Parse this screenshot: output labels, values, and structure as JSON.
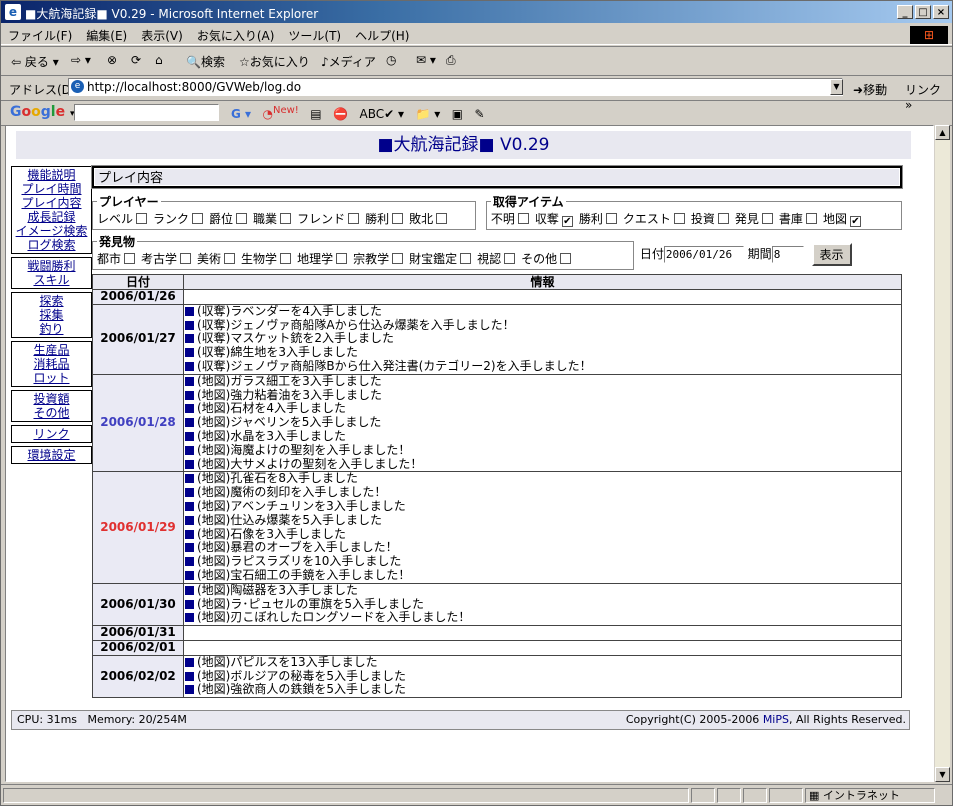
{
  "window": {
    "title": "■大航海記録■ V0.29 - Microsoft Internet Explorer"
  },
  "menu": [
    "ファイル(F)",
    "編集(E)",
    "表示(V)",
    "お気に入り(A)",
    "ツール(T)",
    "ヘルプ(H)"
  ],
  "toolbar": {
    "back": "戻る",
    "search": "検索",
    "favorites": "お気に入り",
    "media": "メディア"
  },
  "address": {
    "label": "アドレス(D)",
    "url": "http://localhost:8000/GVWeb/log.do",
    "go": "移動",
    "links": "リンク"
  },
  "google": {
    "logo": "Google",
    "new_badge": "New!",
    "search_value": ""
  },
  "page": {
    "title": "■大航海記録■ V0.29",
    "section_title": "プレイ内容"
  },
  "sidebar": [
    [
      "機能説明",
      "プレイ時間",
      "プレイ内容",
      "成長記録",
      "イメージ検索",
      "ログ検索"
    ],
    [
      "戦闘勝利",
      "スキル"
    ],
    [
      "探索",
      "採集",
      "釣り"
    ],
    [
      "生産品",
      "消耗品",
      "ロット"
    ],
    [
      "投資額",
      "その他"
    ],
    [
      "リンク"
    ],
    [
      "環境設定"
    ]
  ],
  "filters": {
    "player": {
      "legend": "プレイヤー",
      "items": [
        {
          "label": "レベル",
          "checked": false
        },
        {
          "label": "ランク",
          "checked": false
        },
        {
          "label": "爵位",
          "checked": false
        },
        {
          "label": "職業",
          "checked": false
        },
        {
          "label": "フレンド",
          "checked": false
        },
        {
          "label": "勝利",
          "checked": false
        },
        {
          "label": "敗北",
          "checked": false
        }
      ]
    },
    "items": {
      "legend": "取得アイテム",
      "items": [
        {
          "label": "不明",
          "checked": false
        },
        {
          "label": "収奪",
          "checked": true
        },
        {
          "label": "勝利",
          "checked": false
        },
        {
          "label": "クエスト",
          "checked": false
        },
        {
          "label": "投資",
          "checked": false
        },
        {
          "label": "発見",
          "checked": false
        },
        {
          "label": "書庫",
          "checked": false
        },
        {
          "label": "地図",
          "checked": true
        }
      ]
    },
    "discovery": {
      "legend": "発見物",
      "items": [
        {
          "label": "都市",
          "checked": false
        },
        {
          "label": "考古学",
          "checked": false
        },
        {
          "label": "美術",
          "checked": false
        },
        {
          "label": "生物学",
          "checked": false
        },
        {
          "label": "地理学",
          "checked": false
        },
        {
          "label": "宗教学",
          "checked": false
        },
        {
          "label": "財宝鑑定",
          "checked": false
        },
        {
          "label": "視認",
          "checked": false
        },
        {
          "label": "その他",
          "checked": false
        }
      ]
    },
    "date_label": "日付",
    "date_value": "2006/01/26",
    "period_label": "期間",
    "period_value": "8",
    "show_button": "表示"
  },
  "table": {
    "headers": [
      "日付",
      "情報"
    ],
    "rows": [
      {
        "date": "2006/01/26",
        "style": "",
        "entries": []
      },
      {
        "date": "2006/01/27",
        "style": "",
        "entries": [
          "(収奪)ラベンダーを4入手しました",
          "(収奪)ジェノヴァ商船隊Aから仕込み爆薬を入手しました！",
          "(収奪)マスケット銃を2入手しました",
          "(収奪)綿生地を3入手しました",
          "(収奪)ジェノヴァ商船隊Bから仕入発注書(カテゴリー2)を入手しました！"
        ]
      },
      {
        "date": "2006/01/28",
        "style": "blue",
        "entries": [
          "(地図)ガラス細工を3入手しました",
          "(地図)強力粘着油を3入手しました",
          "(地図)石材を4入手しました",
          "(地図)ジャベリンを5入手しました",
          "(地図)水晶を3入手しました",
          "(地図)海魔よけの聖刻を入手しました！",
          "(地図)大サメよけの聖刻を入手しました！"
        ]
      },
      {
        "date": "2006/01/29",
        "style": "red",
        "entries": [
          "(地図)孔雀石を8入手しました",
          "(地図)魔術の刻印を入手しました！",
          "(地図)アベンチュリンを3入手しました",
          "(地図)仕込み爆薬を5入手しました",
          "(地図)石像を3入手しました",
          "(地図)暴君のオーブを入手しました！",
          "(地図)ラピスラズリを10入手しました",
          "(地図)宝石細工の手鏡を入手しました！"
        ]
      },
      {
        "date": "2006/01/30",
        "style": "",
        "entries": [
          "(地図)陶磁器を3入手しました",
          "(地図)ラ･ピュセルの軍旗を5入手しました",
          "(地図)刃こぼれしたロングソードを入手しました！"
        ]
      },
      {
        "date": "2006/01/31",
        "style": "",
        "entries": []
      },
      {
        "date": "2006/02/01",
        "style": "",
        "entries": []
      },
      {
        "date": "2006/02/02",
        "style": "",
        "entries": [
          "(地図)パピルスを13入手しました",
          "(地図)ボルジアの秘毒を5入手しました",
          "(地図)強欲商人の鉄鎖を5入手しました"
        ]
      }
    ]
  },
  "footer": {
    "cpu": "CPU: 31ms   Memory: 20/254M",
    "copyright_pre": "Copyright(C) 2005-2006 ",
    "copyright_link": "MiPS",
    "copyright_post": ", All Rights Reserved."
  },
  "status": {
    "zone": "イントラネット"
  },
  "colors": {
    "accent": "#00008b",
    "date_blue": "#4040c0",
    "date_red": "#e03030",
    "header_bg": "#e8e8f0"
  }
}
